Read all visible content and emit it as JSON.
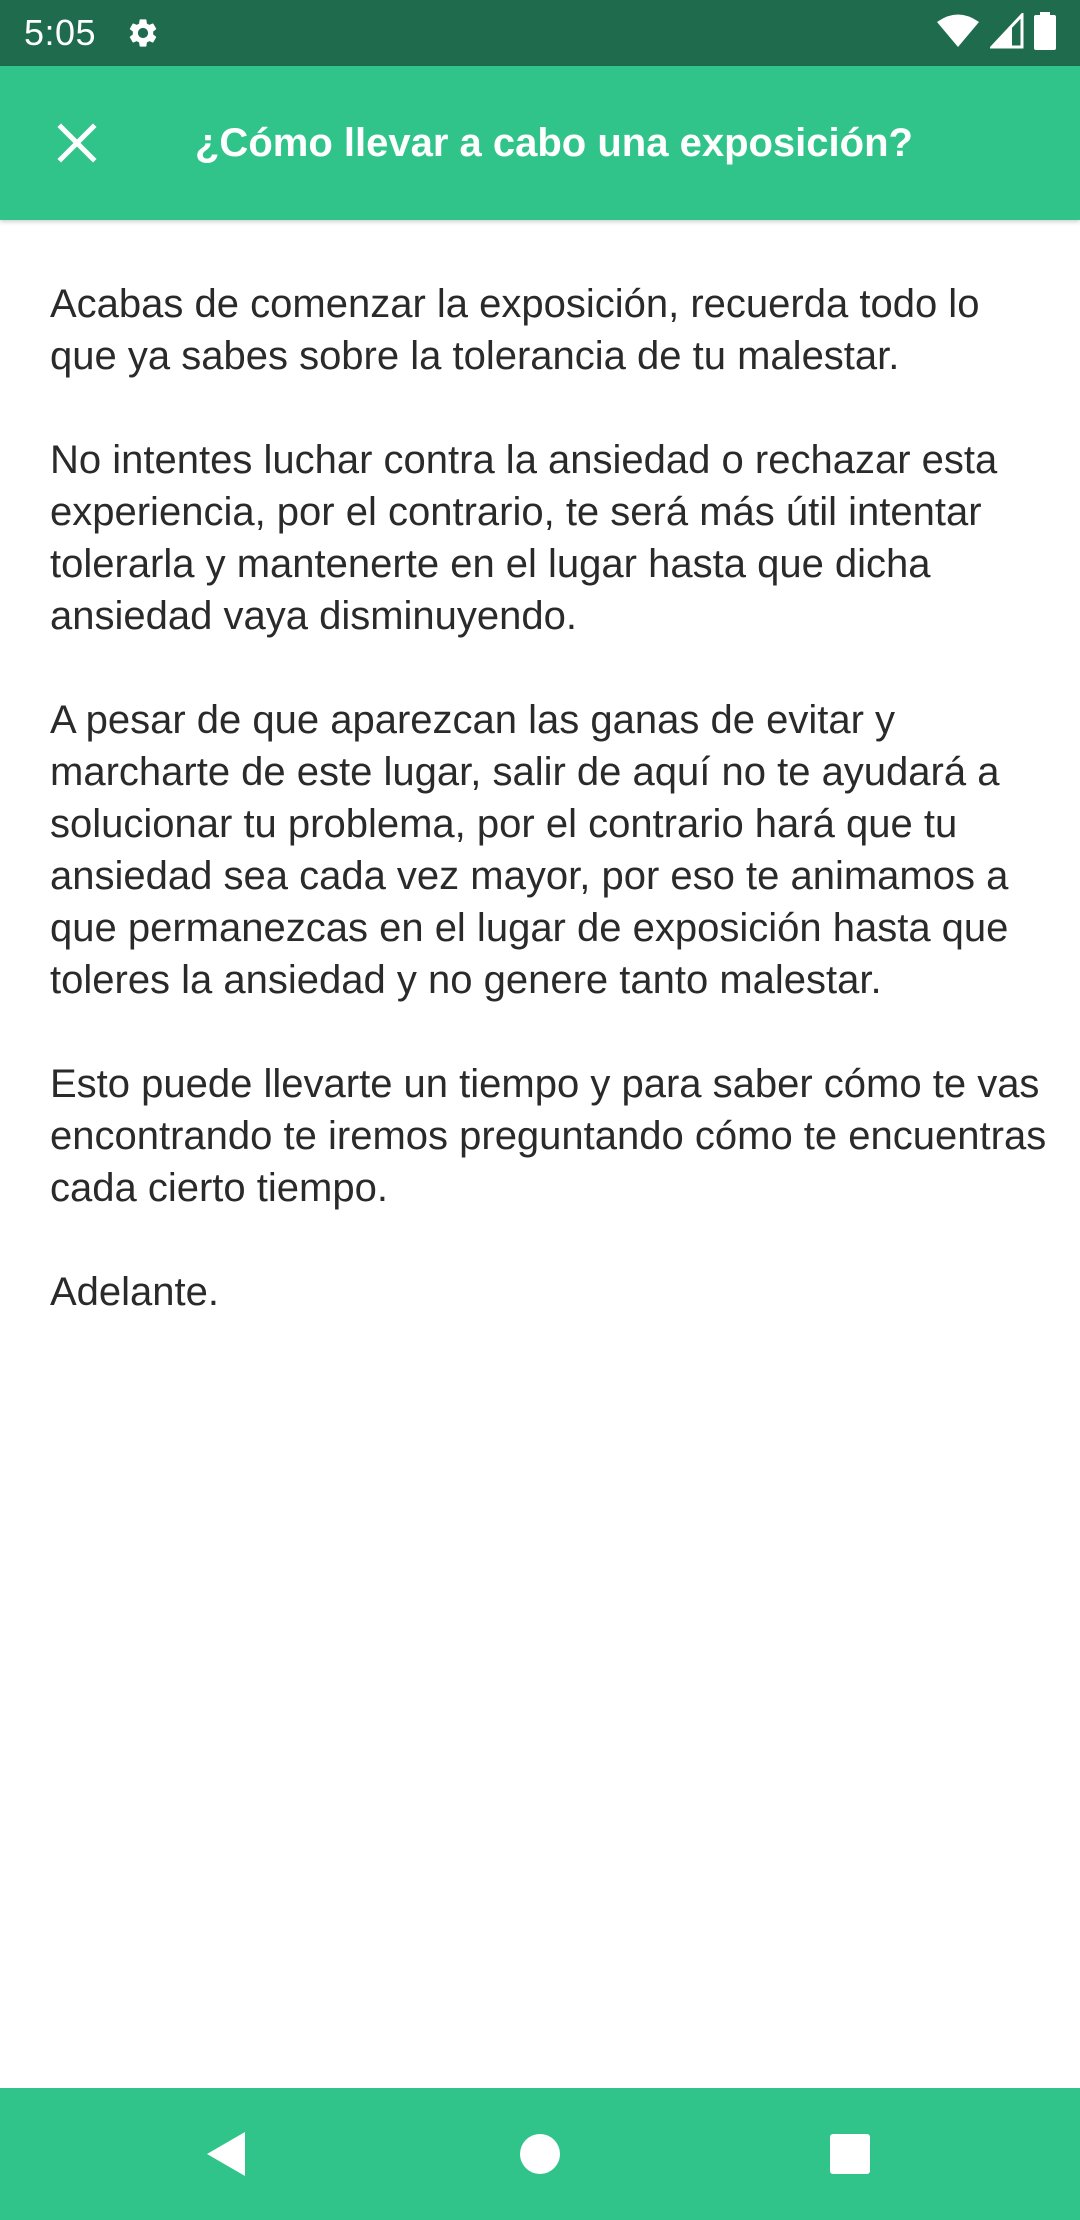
{
  "status_bar": {
    "time": "5:05",
    "icons": [
      "settings-icon",
      "wifi-icon",
      "signal-icon",
      "battery-icon"
    ]
  },
  "app_bar": {
    "close_icon": "close-icon",
    "title": "¿Cómo llevar a cabo una exposición?"
  },
  "content": {
    "paragraphs": [
      "Acabas de comenzar la exposición, recuerda todo lo que ya sabes sobre la tolerancia de tu malestar.",
      "No intentes luchar contra la ansiedad o rechazar esta experiencia, por el contrario, te será más útil intentar tolerarla y mantenerte en el lugar hasta que dicha ansiedad vaya disminuyendo.",
      "A pesar de que aparezcan las ganas de evitar y marcharte de este lugar, salir de aquí no te ayudará a solucionar tu problema, por el contrario hará que tu ansiedad sea cada vez mayor, por eso te animamos a que permanezcas en el lugar de exposición hasta que toleres la ansiedad y no genere tanto malestar.",
      "Esto puede llevarte un tiempo y para saber cómo te vas encontrando te iremos preguntando cómo te encuentras cada cierto tiempo.",
      "Adelante."
    ]
  },
  "nav_bar": {
    "icons": [
      "back-icon",
      "home-icon",
      "recents-icon"
    ]
  },
  "colors": {
    "status_bar": "#1e6b4e",
    "app_bar": "#31c48a",
    "nav_bar": "#31c48a",
    "text": "#2a2a2a"
  }
}
